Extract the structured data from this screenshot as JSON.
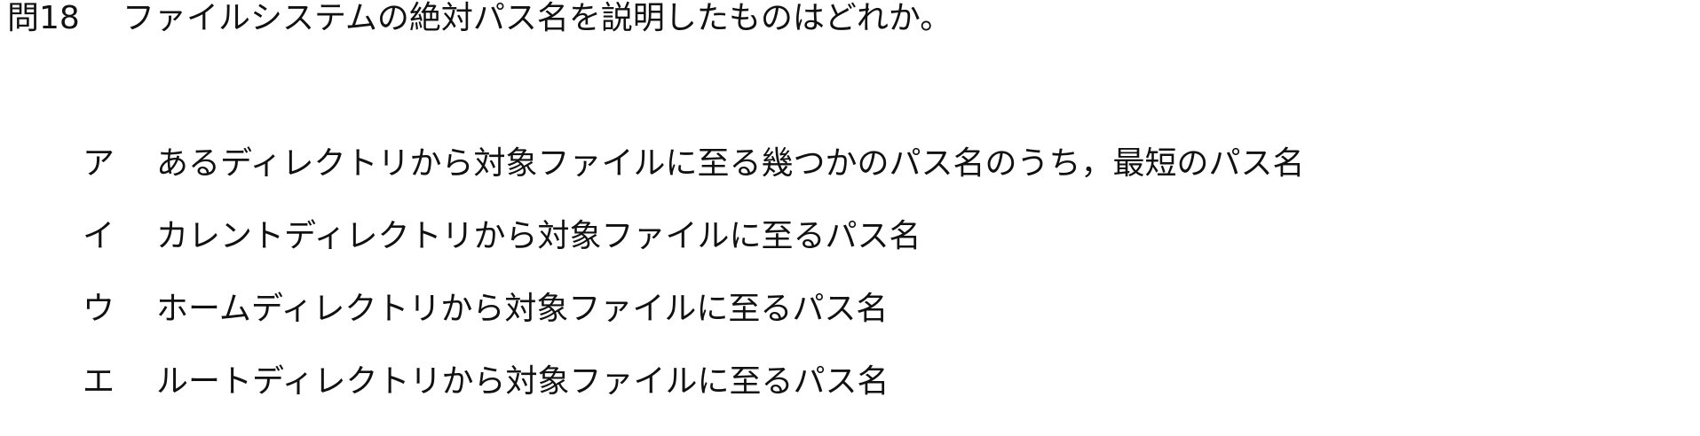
{
  "question": {
    "number": "問18",
    "text": "ファイルシステムの絶対パス名を説明したものはどれか。"
  },
  "choices": [
    {
      "letter": "ア",
      "text": "あるディレクトリから対象ファイルに至る幾つかのパス名のうち，最短のパス名"
    },
    {
      "letter": "イ",
      "text": "カレントディレクトリから対象ファイルに至るパス名"
    },
    {
      "letter": "ウ",
      "text": "ホームディレクトリから対象ファイルに至るパス名"
    },
    {
      "letter": "エ",
      "text": "ルートディレクトリから対象ファイルに至るパス名"
    }
  ]
}
